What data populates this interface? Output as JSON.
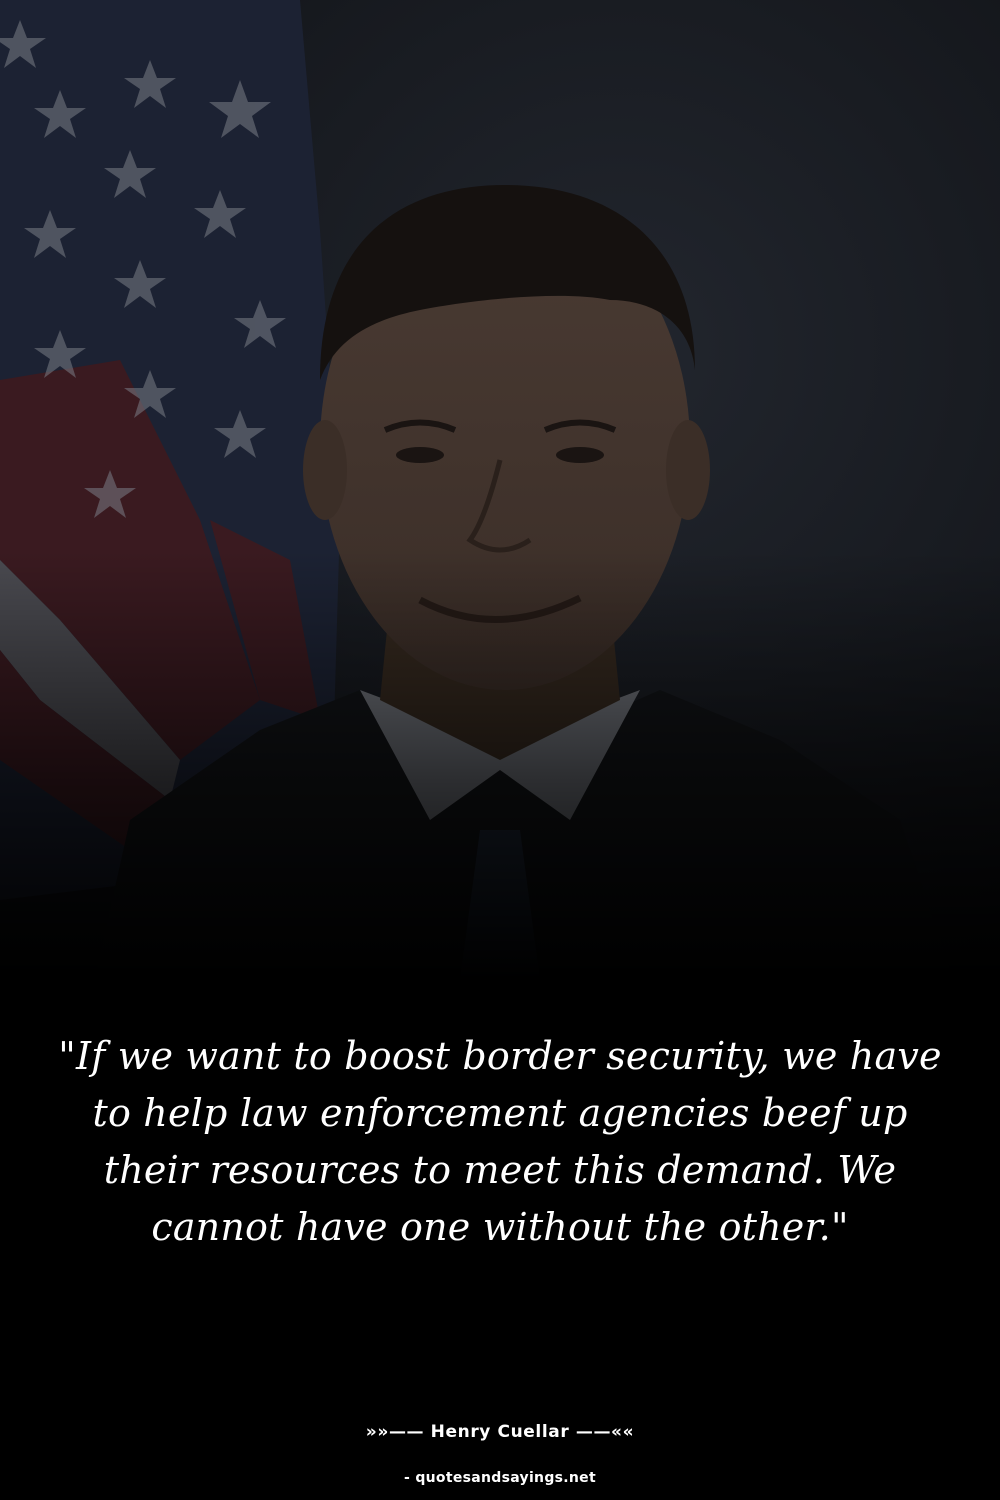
{
  "quote": {
    "text": "\"If we want to boost border security, we have to help law enforcement agencies beef up their resources to meet this demand. We cannot have one without the other.\""
  },
  "attribution": {
    "author_line": "»»—— Henry Cuellar ——««",
    "source": "- quotesandsayings.net"
  },
  "colors": {
    "background": "#000000",
    "text": "#ffffff"
  }
}
